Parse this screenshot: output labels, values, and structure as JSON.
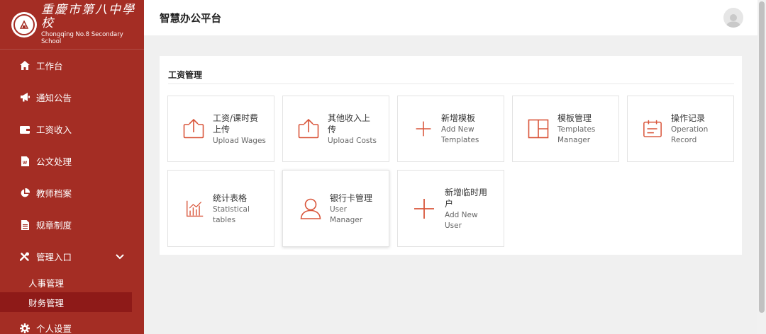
{
  "logo": {
    "cn": "重慶市第八中學校",
    "en": "Chongqing No.8 Secondary School"
  },
  "header": {
    "title": "智慧办公平台"
  },
  "sidebar": {
    "items": [
      {
        "label": "工作台",
        "icon": "home-icon"
      },
      {
        "label": "通知公告",
        "icon": "megaphone-icon"
      },
      {
        "label": "工资收入",
        "icon": "wallet-icon"
      },
      {
        "label": "公文处理",
        "icon": "word-document-icon"
      },
      {
        "label": "教师档案",
        "icon": "pie-chart-icon"
      },
      {
        "label": "规章制度",
        "icon": "document-icon"
      },
      {
        "label": "管理入口",
        "icon": "tools-icon"
      }
    ],
    "sub_items": [
      {
        "label": "人事管理"
      },
      {
        "label": "财务管理"
      }
    ],
    "settings": {
      "label": "个人设置",
      "icon": "gear-icon"
    }
  },
  "main": {
    "section_title": "工资管理",
    "tiles": [
      {
        "cn1": "工资/课时费",
        "cn2": "上传",
        "en1": "Upload Wages",
        "en2": "",
        "icon": "upload-icon"
      },
      {
        "cn1": "其他收入上",
        "cn2": "传",
        "en1": "Upload Costs",
        "en2": "",
        "icon": "upload-icon"
      },
      {
        "cn1": "新增模板",
        "cn2": "",
        "en1": "Add New",
        "en2": "Templates",
        "icon": "plus-icon"
      },
      {
        "cn1": "模板管理",
        "cn2": "",
        "en1": "Templates",
        "en2": "Manager",
        "icon": "layout-icon"
      },
      {
        "cn1": "操作记录",
        "cn2": "",
        "en1": "Operation",
        "en2": "Record",
        "icon": "calendar-icon"
      },
      {
        "cn1": "统计表格",
        "cn2": "",
        "en1": "Statistical",
        "en2": "tables",
        "icon": "bar-chart-icon"
      },
      {
        "cn1": "银行卡管理",
        "cn2": "",
        "en1": "User",
        "en2": "Manager",
        "icon": "user-icon"
      },
      {
        "cn1": "新增临时用",
        "cn2": "户",
        "en1": "Add New",
        "en2": "User",
        "icon": "plus-icon"
      }
    ]
  },
  "colors": {
    "sidebar": "#a42d24",
    "active": "#8e1a18",
    "accent": "#d9553a"
  }
}
